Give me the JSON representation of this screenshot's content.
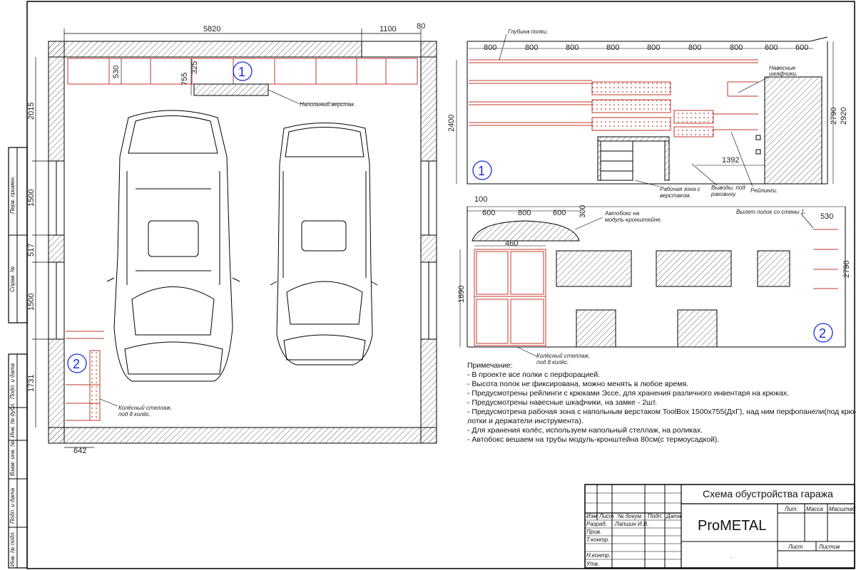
{
  "plan": {
    "dims_top": [
      "5820",
      "1100",
      "80"
    ],
    "dims_left": [
      "2015",
      "1500",
      "517",
      "1500",
      "1731"
    ],
    "dims_inner": [
      "530",
      "755",
      "325"
    ],
    "dim_bottom": "642",
    "marker1": "1",
    "marker2": "2",
    "workbench_label": "Напольный верстак.",
    "tire_rack_label_1": "Колёсный стеллаж,",
    "tire_rack_label_2": "под 8 колёс."
  },
  "elev1": {
    "top_label": "Глубина полки.",
    "widths": [
      "800",
      "800",
      "800",
      "800",
      "800",
      "800",
      "800",
      "600",
      "600"
    ],
    "height_left": "2400",
    "height_right_1": "2790",
    "height_right_2": "2920",
    "dim_1392": "1392",
    "marker": "1",
    "cabinets_label_1": "Навесные",
    "cabinets_label_2": "шкафчики.",
    "workzone_label_1": "Рабочая зона с",
    "workzone_label_2": "верстаком.",
    "outlets_label_1": "Выводы, под",
    "outlets_label_2": "раковину.",
    "rails_label": "Рейлинги."
  },
  "elev2": {
    "dims_top": [
      "100",
      "600",
      "800",
      "600",
      "300"
    ],
    "dim_460": "460",
    "height_left": "1890",
    "height_right": "2790",
    "dim_530": "530",
    "marker": "2",
    "autobox_label_1": "Автобокс на",
    "autobox_label_2": "модуль-кронштейне.",
    "shelf_label": "Вылет полок со стены 1.",
    "tire_label_1": "Колёсный стеллаж,",
    "tire_label_2": "под 8 колёс."
  },
  "notes": {
    "heading": "Примечание:",
    "lines": [
      "- В проекте все полки с перфорацией.",
      "- Высота полок не фиксирована, можно менять в любое время.",
      "- Предусмотрены рейлинги с крюками Эссе, для хранения различного инвентаря на крюках.",
      "- Предусмотрены навесные шкафчики, на замке - 2шт.",
      "- Предусмотрена рабочая зона с напольным верстаком ToolBox 1500х755(ДхГ), над ним перфопанели(под крючки,",
      "лотки и держатели инструмента).",
      "- Для хранения колёс, используем напольный стеллаж, на роликах.",
      "- Автобокс вешаем на трубы модуль-кронштейна 80см(с термоусадкой)."
    ]
  },
  "sidebar": {
    "labels": [
      "Перв. примен.",
      "Справ. №",
      "Подп. и дата",
      "Инв. № дубл.",
      "Взам. инв. №",
      "Подп. и дата",
      "Инв. № подл."
    ]
  },
  "titleblock": {
    "title": "Схема обустройства гаража",
    "company": "ProMETAL",
    "col_lit": "Лит.",
    "col_mass": "Масса",
    "col_scale": "Масштаб",
    "row_head": [
      "Изм",
      "Лист",
      "№ докум.",
      "Подп.",
      "Дата"
    ],
    "razrab": "Разраб.",
    "razrab_name": "Лапшин И.В.",
    "prov": "Пров.",
    "tkontr": "Т.контр.",
    "nkontr": "Н.контр.",
    "utv": "Утв.",
    "list": "Лист",
    "listov": "Листов",
    "dot": "."
  }
}
